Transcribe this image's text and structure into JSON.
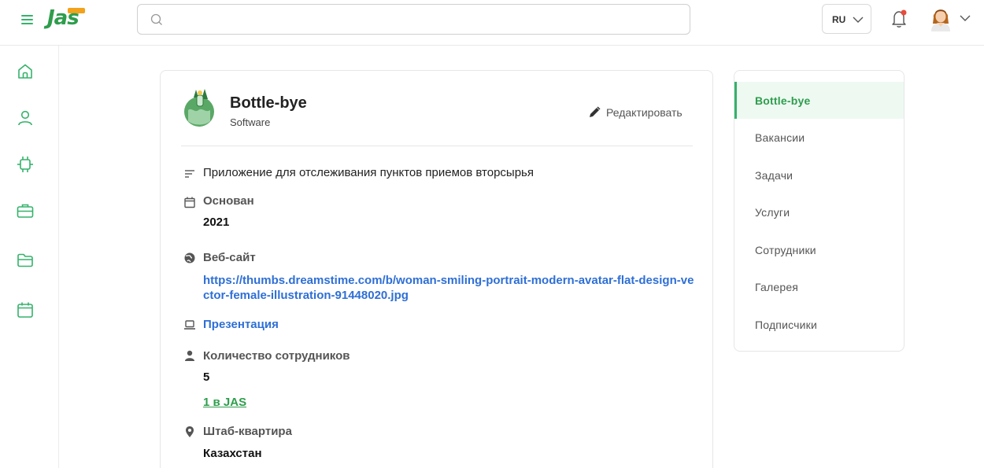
{
  "header": {
    "logo_text": "Jas",
    "search_placeholder": "",
    "language": "RU",
    "notification_dot_color": "#e74c3c"
  },
  "rail": {
    "items": [
      "home-icon",
      "user-icon",
      "chip-icon",
      "briefcase-icon",
      "folder-icon",
      "calendar-icon"
    ],
    "accent": "#35b26b"
  },
  "company": {
    "name": "Bottle-bye",
    "type": "Software",
    "edit_label": "Редактировать",
    "description": "Приложение для отслеживания пунктов приемов вторсырья",
    "founded_label": "Основан",
    "founded_value": "2021",
    "website_label": "Веб-сайт",
    "website_url": "https://thumbs.dreamstime.com/b/woman-smiling-portrait-modern-avatar-flat-design-vector-female-illustration-91448020.jpg",
    "presentation_label": "Презентация",
    "employees_label": "Количество сотрудников",
    "employees_value": "5",
    "employees_in_jas": "1 в JAS",
    "hq_label": "Штаб-квартира",
    "hq_value": "Казахстан"
  },
  "side_nav": {
    "items": [
      {
        "label": "Bottle-bye",
        "active": true
      },
      {
        "label": "Вакансии",
        "active": false
      },
      {
        "label": "Задачи",
        "active": false
      },
      {
        "label": "Услуги",
        "active": false
      },
      {
        "label": "Сотрудники",
        "active": false
      },
      {
        "label": "Галерея",
        "active": false
      },
      {
        "label": "Подписчики",
        "active": false
      }
    ]
  },
  "colors": {
    "brand_green": "#2e9d4c",
    "link_blue": "#2e6fd6",
    "active_bg": "#eef9f2"
  }
}
